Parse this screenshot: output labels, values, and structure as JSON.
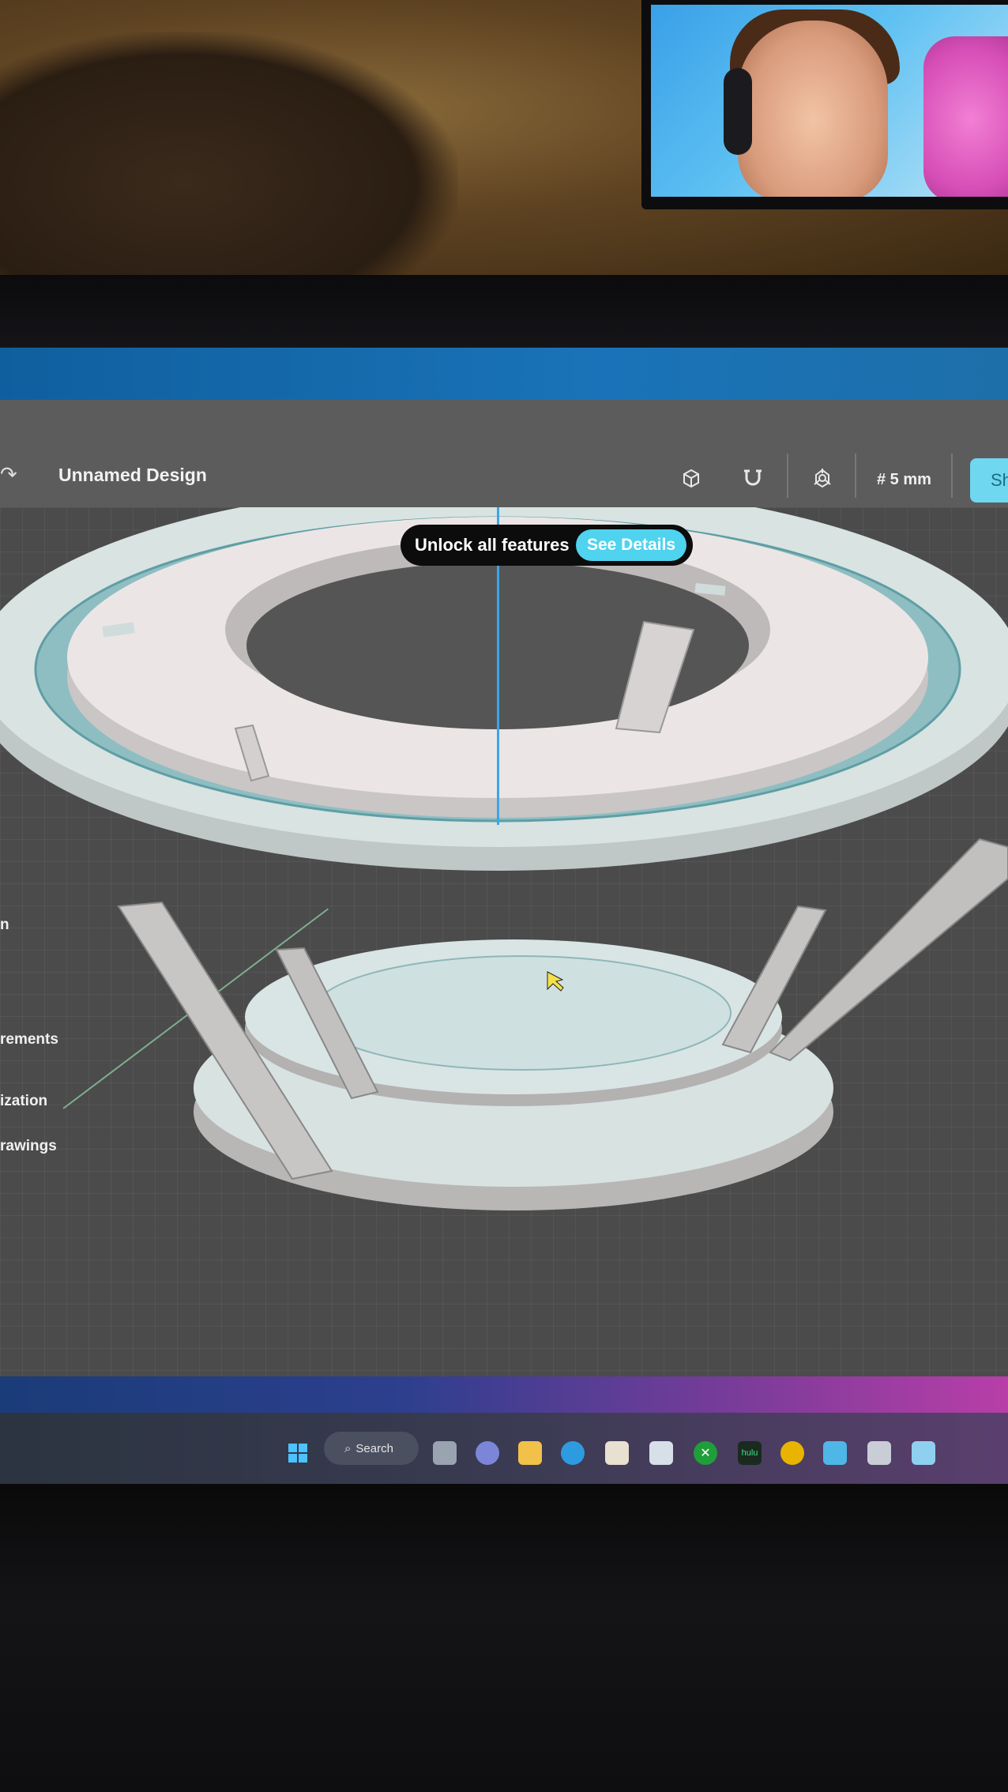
{
  "app": {
    "design_title": "Unnamed Design",
    "grid_size": "# 5 mm",
    "share_label": "Sh"
  },
  "toolbar": {
    "icons": [
      "redo-icon",
      "cube-view-icon",
      "magnet-snap-icon",
      "perspective-icon"
    ]
  },
  "banner": {
    "text": "Unlock all features",
    "button": "See Details"
  },
  "sidebar": {
    "items": [
      {
        "label": "n"
      },
      {
        "label": "rements"
      },
      {
        "label": "ization"
      },
      {
        "label": "rawings"
      }
    ]
  },
  "taskbar": {
    "search_label": "Search",
    "apps": [
      "windows-start",
      "search",
      "task-view",
      "chat",
      "file-explorer",
      "edge",
      "store",
      "photos",
      "xbox",
      "hulu",
      "chrome",
      "design-app",
      "media",
      "notes"
    ]
  },
  "colors": {
    "accent": "#4fd3ee",
    "toolbar_bg": "#5c5c5c",
    "viewport_bg": "#4b4b4b",
    "axis_blue": "#3aa6e8"
  }
}
